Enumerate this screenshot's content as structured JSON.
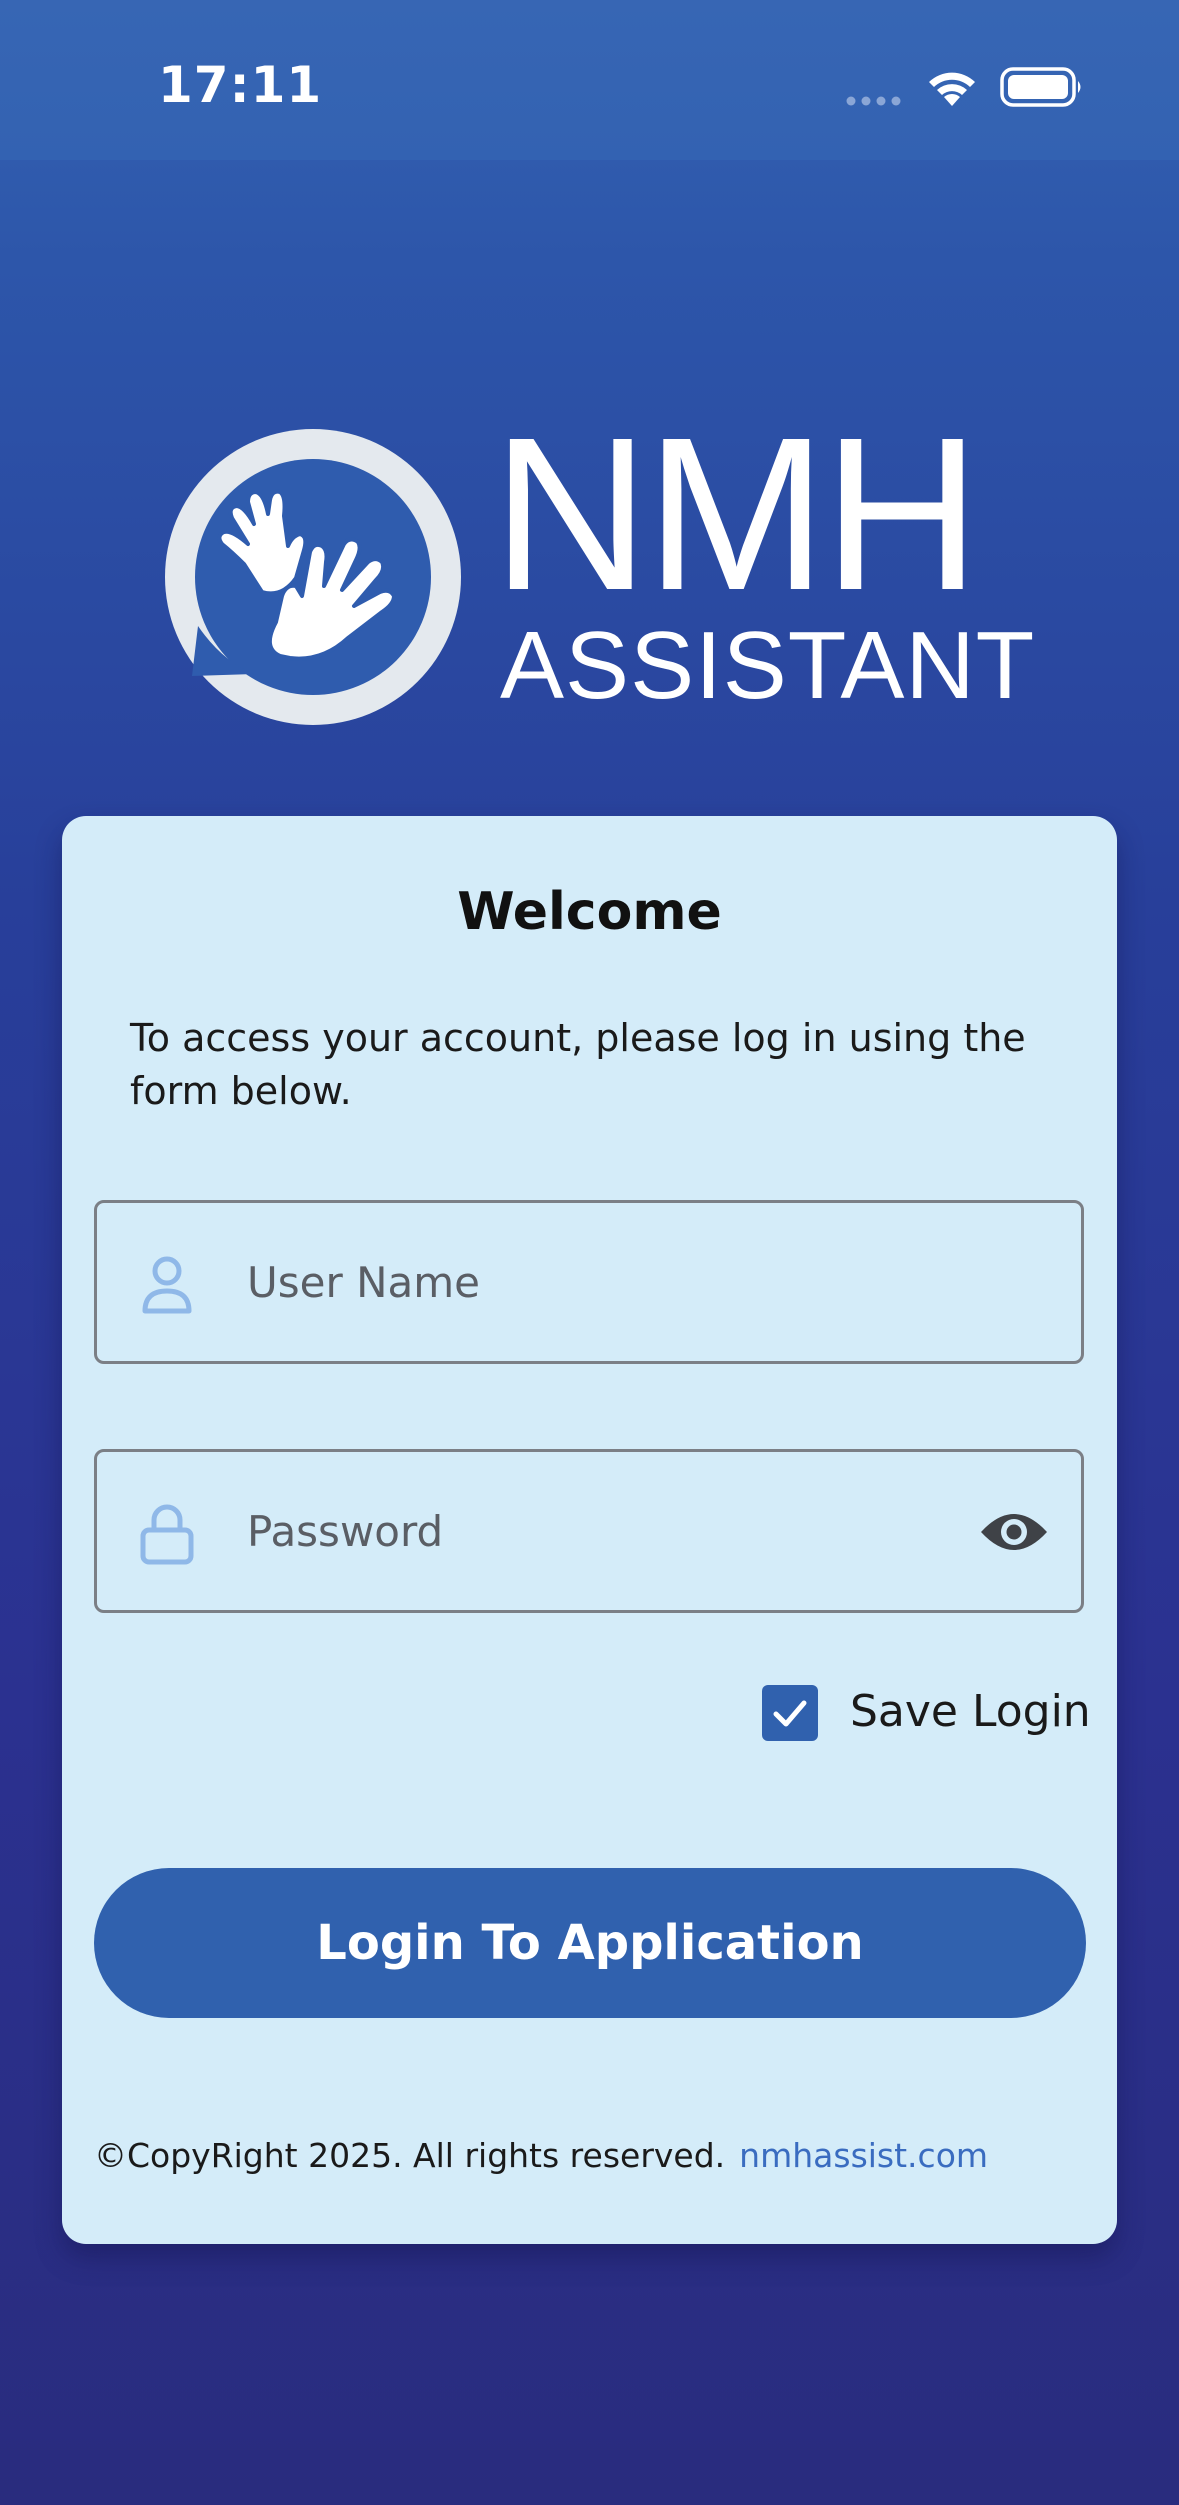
{
  "status_bar": {
    "time": "17:11"
  },
  "logo": {
    "title": "NMH",
    "subtitle": "ASSISTANT"
  },
  "login_card": {
    "heading": "Welcome",
    "intro": "To access your account, please log in using the form below.",
    "username": {
      "placeholder": "User Name",
      "value": ""
    },
    "password": {
      "placeholder": "Password",
      "value": ""
    },
    "save_login": {
      "label": "Save Login",
      "checked": true
    },
    "login_button": "Login To Application",
    "footer": {
      "copyright": "©CopyRight 2025. All rights reserved.",
      "link": "nmhassist.com"
    }
  },
  "colors": {
    "accent": "#3061ae",
    "card_background": "#d4ecf9",
    "link": "#3a6cc0",
    "field_icon": "#8fb8e8"
  }
}
